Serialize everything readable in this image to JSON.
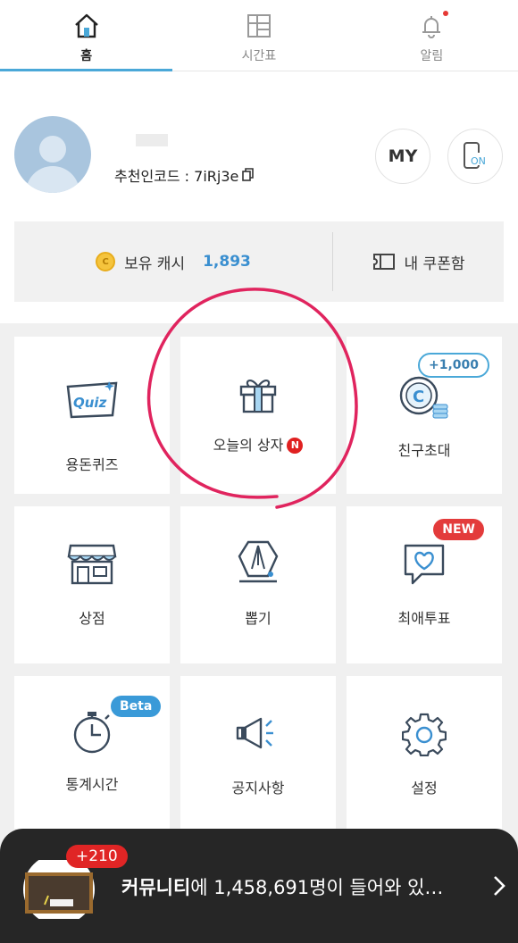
{
  "tabs": [
    {
      "label": "홈",
      "icon": "home-icon",
      "active": true
    },
    {
      "label": "시간표",
      "icon": "timetable-icon",
      "active": false
    },
    {
      "label": "알림",
      "icon": "bell-icon",
      "active": false
    }
  ],
  "profile": {
    "ref_code_label": "추천인코드 : 7iRj3e",
    "my_button": "MY",
    "on_button": "ON"
  },
  "cash": {
    "label": "보유 캐시",
    "amount": "1,893",
    "coin_letter": "C",
    "coupon_label": "내 쿠폰함"
  },
  "grid": [
    {
      "label": "용돈퀴즈",
      "icon": "quiz-icon",
      "icon_text": "Quiz"
    },
    {
      "label": "오늘의 상자",
      "icon": "gift-box-icon",
      "badge": "N"
    },
    {
      "label": "친구초대",
      "icon": "coin-stack-icon",
      "bubble": "+1,000",
      "coin_letter": "C"
    },
    {
      "label": "상점",
      "icon": "store-icon"
    },
    {
      "label": "뽑기",
      "icon": "claw-machine-icon"
    },
    {
      "label": "최애투표",
      "icon": "heart-chat-icon",
      "bubble": "NEW"
    },
    {
      "label": "통계시간",
      "icon": "stopwatch-icon",
      "bubble": "Beta"
    },
    {
      "label": "공지사항",
      "icon": "megaphone-icon"
    },
    {
      "label": "설정",
      "icon": "gear-icon"
    }
  ],
  "banner": {
    "reward": "+210",
    "bold": "커뮤니티",
    "text": "에 1,458,691명이 들어와 있…"
  },
  "colors": {
    "accent": "#4aa8d8",
    "badge_red": "#e02020",
    "annotation": "#e0245e",
    "banner_bg": "#262626"
  }
}
